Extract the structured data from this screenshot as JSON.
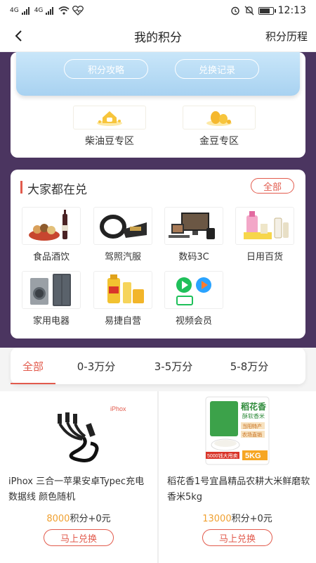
{
  "status": {
    "network_1": "4G",
    "network_2": "4G",
    "time": "12:13",
    "battery_level": 0.85
  },
  "nav": {
    "back_icon": "chevron-left-icon",
    "title": "我的积分",
    "history_label": "积分历程"
  },
  "top": {
    "strategy_label": "积分攻略",
    "record_label": "兑换记录"
  },
  "zones": [
    {
      "label": "柴油豆专区",
      "icon": "bean-basket-icon"
    },
    {
      "label": "金豆专区",
      "icon": "gold-bean-icon"
    }
  ],
  "popular": {
    "title": "大家都在兑",
    "all_label": "全部",
    "categories": [
      {
        "label": "食品酒饮",
        "icon": "food-wine-icon"
      },
      {
        "label": "驾照汽服",
        "icon": "car-service-icon"
      },
      {
        "label": "数码3C",
        "icon": "digital-devices-icon"
      },
      {
        "label": "日用百货",
        "icon": "daily-goods-icon"
      },
      {
        "label": "家用电器",
        "icon": "appliances-icon"
      },
      {
        "label": "易捷自营",
        "icon": "yijie-products-icon"
      },
      {
        "label": "视频会员",
        "icon": "video-vip-icon"
      }
    ]
  },
  "tabs": [
    {
      "label": "全部",
      "active": true
    },
    {
      "label": "0-3万分",
      "active": false
    },
    {
      "label": "3-5万分",
      "active": false
    },
    {
      "label": "5-8万分",
      "active": false
    }
  ],
  "products": [
    {
      "brand_text": "iPhox",
      "name": "iPhox 三合一苹果安卓Typec充电数据线 颜色随机",
      "points": "8000",
      "price_suffix": "积分+0元",
      "buy_label": "马上兑换"
    },
    {
      "pack_brand": "稻花香",
      "pack_sub": "酥软香米",
      "pack_tag_1": "当阳特产",
      "pack_tag_2": "农场直销",
      "pack_badge": "5000钱大甩卖",
      "pack_weight": "5KG",
      "name": "稻花香1号宜昌精品农耕大米鲜磨软香米5kg",
      "points": "13000",
      "price_suffix": "积分+0元",
      "buy_label": "马上兑换"
    }
  ],
  "colors": {
    "accent": "#e25b4d",
    "points": "#f0a030",
    "backdrop": "#4b3560",
    "blue_panel": "#b5dbf4"
  }
}
